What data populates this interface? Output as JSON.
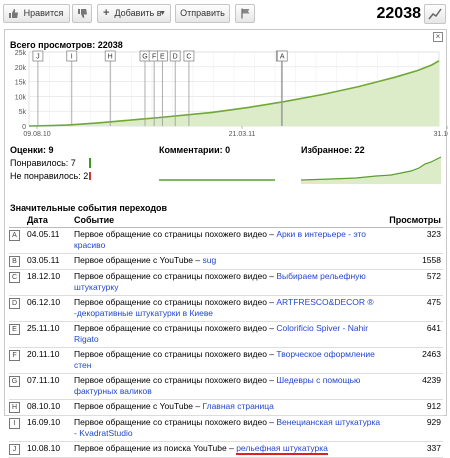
{
  "toolbar": {
    "like_label": "Нравится",
    "add_label": "Добавить в",
    "share_label": "Отправить",
    "view_count": "22038"
  },
  "panel": {
    "total_views_label": "Всего просмотров: 22038",
    "ratings_label": "Оценки: 9",
    "likes_label": "Понравилось: 7",
    "dislikes_label": "Не понравилось: 2",
    "comments_label": "Комментарии: 0",
    "favorites_label": "Избранное: 22",
    "events_title": "Значительные события переходов"
  },
  "chart_data": {
    "type": "area",
    "title": "Всего просмотров: 22038",
    "y_ticks": [
      "25k",
      "20k",
      "15k",
      "10k",
      "5k",
      "0"
    ],
    "ylim": [
      0,
      25000
    ],
    "x_ticks": [
      "09.08.10",
      "21.03.11",
      "31.10.11"
    ],
    "x_tick_positions_days": [
      0,
      224,
      448
    ],
    "x": [
      0,
      24,
      41,
      56,
      73,
      88,
      103,
      117,
      137,
      200,
      240,
      280,
      320,
      360,
      400,
      425,
      440,
      448
    ],
    "y": [
      0,
      120,
      300,
      620,
      980,
      1400,
      1800,
      2150,
      2700,
      4600,
      6300,
      8300,
      10600,
      13300,
      16500,
      18800,
      20600,
      22038
    ],
    "markers": [
      {
        "letter": "J",
        "day": 1
      },
      {
        "letter": "I",
        "day": 38
      },
      {
        "letter": "H",
        "day": 80
      },
      {
        "letter": "G",
        "day": 118
      },
      {
        "letter": "F",
        "day": 128
      },
      {
        "letter": "E",
        "day": 137
      },
      {
        "letter": "D",
        "day": 151
      },
      {
        "letter": "C",
        "day": 166
      },
      {
        "letter": "B",
        "day": 267
      },
      {
        "letter": "A",
        "day": 268
      }
    ],
    "grid": true,
    "color": "#6fa836",
    "fill": "#dcebc8"
  },
  "events": {
    "headers": {
      "date": "Дата",
      "event": "Событие",
      "views": "Просмотры"
    },
    "rows": [
      {
        "letter": "A",
        "date": "04.05.11",
        "text": "Первое обращение со страницы похожего видео – ",
        "link": "Арки в интерьере - это красиво",
        "views": "323",
        "underline": false
      },
      {
        "letter": "B",
        "date": "03.05.11",
        "text": "Первое обращение с YouTube – ",
        "link": "sug",
        "views": "1558",
        "underline": false
      },
      {
        "letter": "C",
        "date": "18.12.10",
        "text": "Первое обращение со страницы похожего видео – ",
        "link": "Выбираем рельефную штукатурку",
        "views": "572",
        "underline": false
      },
      {
        "letter": "D",
        "date": "06.12.10",
        "text": "Первое обращение со страницы похожего видео – ",
        "link": "ARTFRESCO&DECOR ® -декоративные штукатурки в Киеве",
        "views": "475",
        "underline": false
      },
      {
        "letter": "E",
        "date": "25.11.10",
        "text": "Первое обращение со страницы похожего видео – ",
        "link": "Colorificio Spiver - Nahir Rigato",
        "views": "641",
        "underline": false
      },
      {
        "letter": "F",
        "date": "20.11.10",
        "text": "Первое обращение со страницы похожего видео – ",
        "link": "Творческое оформление стен",
        "views": "2463",
        "underline": false
      },
      {
        "letter": "G",
        "date": "07.11.10",
        "text": "Первое обращение со страницы похожего видео – ",
        "link": "Шедевры с помощью фактурных валиков",
        "views": "4239",
        "underline": false
      },
      {
        "letter": "H",
        "date": "08.10.10",
        "text": "Первое обращение с YouTube – ",
        "link": "Главная страница",
        "views": "912",
        "underline": false
      },
      {
        "letter": "I",
        "date": "16.09.10",
        "text": "Первое обращение со страницы похожего видео – ",
        "link": "Венецианская штукатурка - KvadratStudio",
        "views": "929",
        "underline": false
      },
      {
        "letter": "J",
        "date": "10.08.10",
        "text": "Первое обращение из поиска YouTube – ",
        "link": "рельефная штукатурка",
        "views": "337",
        "underline": true
      }
    ]
  }
}
